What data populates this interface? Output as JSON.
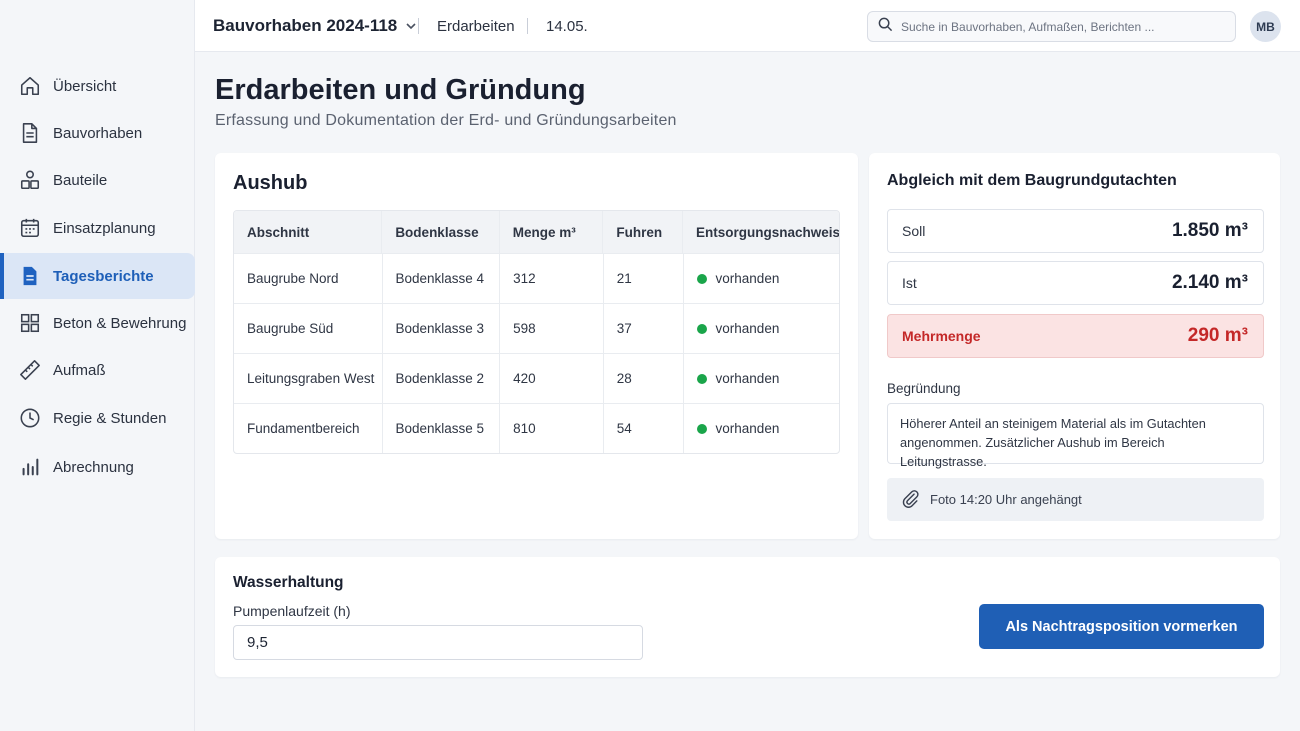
{
  "header": {
    "project": "Bauvorhaben 2024-118",
    "section": "Erdarbeiten",
    "date": "14.05.",
    "search_placeholder": "Suche in Bauvorhaben, Aufmaßen, Berichten ...",
    "avatar_initials": "MB"
  },
  "sidebar": {
    "items": [
      {
        "label": "Übersicht",
        "icon": "home-icon"
      },
      {
        "label": "Bauvorhaben",
        "icon": "document-icon"
      },
      {
        "label": "Bauteile",
        "icon": "shapes-icon"
      },
      {
        "label": "Einsatzplanung",
        "icon": "calendar-icon"
      },
      {
        "label": "Tagesberichte",
        "icon": "report-icon",
        "active": true
      },
      {
        "label": "Beton & Bewehrung",
        "icon": "grid-icon"
      },
      {
        "label": "Aufmaß",
        "icon": "ruler-icon"
      },
      {
        "label": "Regie & Stunden",
        "icon": "clock-icon"
      },
      {
        "label": "Abrechnung",
        "icon": "bar-chart-icon"
      }
    ]
  },
  "page": {
    "title": "Erdarbeiten und Gründung",
    "subtitle": "Erfassung und Dokumentation der Erd- und Gründungsarbeiten"
  },
  "aushub": {
    "title": "Aushub",
    "columns": [
      "Abschnitt",
      "Bodenklasse",
      "Menge m³",
      "Fuhren",
      "Entsorgungsnachweis"
    ],
    "rows": [
      {
        "abschnitt": "Baugrube Nord",
        "bodenklasse": "Bodenklasse 4",
        "menge": "312",
        "fuhren": "21",
        "nachweis": "vorhanden"
      },
      {
        "abschnitt": "Baugrube Süd",
        "bodenklasse": "Bodenklasse 3",
        "menge": "598",
        "fuhren": "37",
        "nachweis": "vorhanden"
      },
      {
        "abschnitt": "Leitungsgraben West",
        "bodenklasse": "Bodenklasse 2",
        "menge": "420",
        "fuhren": "28",
        "nachweis": "vorhanden"
      },
      {
        "abschnitt": "Fundamentbereich",
        "bodenklasse": "Bodenklasse 5",
        "menge": "810",
        "fuhren": "54",
        "nachweis": "vorhanden"
      }
    ],
    "status_color": "#1aa54a"
  },
  "abgleich": {
    "title": "Abgleich mit dem Baugrundgutachten",
    "soll_label": "Soll",
    "soll_value": "1.850 m³",
    "ist_label": "Ist",
    "ist_value": "2.140 m³",
    "mehr_label": "Mehrmenge",
    "mehr_value": "290 m³",
    "begruendung_label": "Begründung",
    "begruendung_text": "Höherer Anteil an steinigem Material als im Gutachten angenommen. Zusätzlicher Aushub im Bereich Leitungstrasse.",
    "attachment": "Foto 14:20 Uhr angehängt"
  },
  "wasserhaltung": {
    "title": "Wasserhaltung",
    "pump_label": "Pumpenlaufzeit (h)",
    "pump_value": "9,5",
    "button": "Als Nachtragsposition vormerken"
  },
  "colors": {
    "accent": "#1f5fb5",
    "danger": "#c42828",
    "active_nav_bg": "#dbe6f6"
  }
}
